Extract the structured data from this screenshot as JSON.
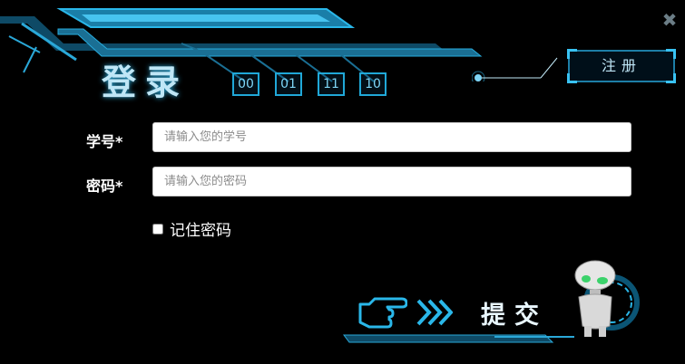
{
  "header": {
    "title": "登录",
    "codes": [
      "00",
      "01",
      "11",
      "10"
    ]
  },
  "window": {
    "close_icon": "close-icon"
  },
  "register": {
    "label": "注册"
  },
  "form": {
    "student_id": {
      "label": "学号*",
      "placeholder": "请输入您的学号",
      "value": ""
    },
    "password": {
      "label": "密码*",
      "placeholder": "请输入您的密码",
      "value": ""
    },
    "remember": {
      "label": "记住密码",
      "checked": false
    }
  },
  "submit": {
    "label": "提交",
    "icons": [
      "pointing-hand-icon",
      "double-chevron-right-icon",
      "robot-icon"
    ]
  },
  "colors": {
    "background": "#000000",
    "accent": "#20a8d8",
    "accent_light": "#7fd6f7",
    "title": "#bfe6f6"
  }
}
